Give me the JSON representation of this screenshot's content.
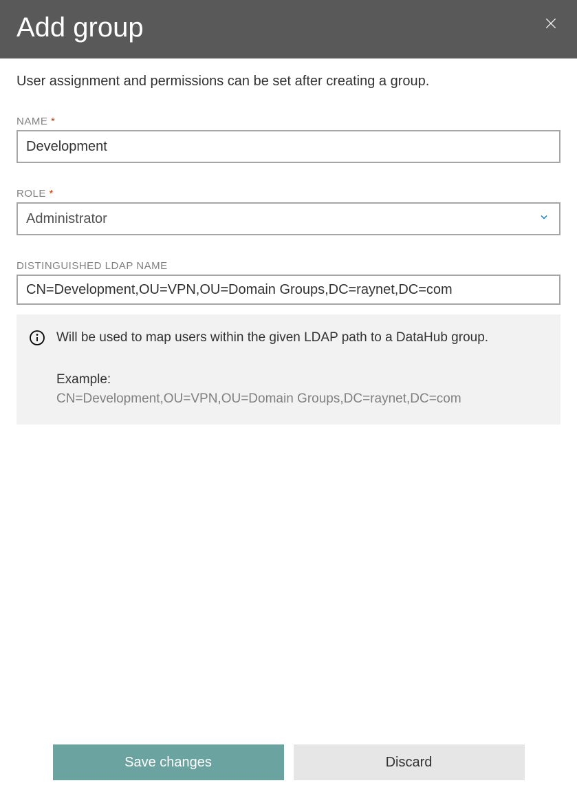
{
  "header": {
    "title": "Add group"
  },
  "description": "User assignment and permissions can be set after creating a group.",
  "fields": {
    "name": {
      "label": "NAME",
      "required": "*",
      "value": "Development"
    },
    "role": {
      "label": "ROLE",
      "required": "*",
      "value": "Administrator"
    },
    "ldap": {
      "label": "DISTINGUISHED LDAP NAME",
      "value": "CN=Development,OU=VPN,OU=Domain Groups,DC=raynet,DC=com"
    }
  },
  "info": {
    "text": "Will be used to map users within the given LDAP path to a DataHub group.",
    "exampleLabel": "Example:",
    "exampleValue": "CN=Development,OU=VPN,OU=Domain Groups,DC=raynet,DC=com"
  },
  "buttons": {
    "save": "Save changes",
    "discard": "Discard"
  }
}
